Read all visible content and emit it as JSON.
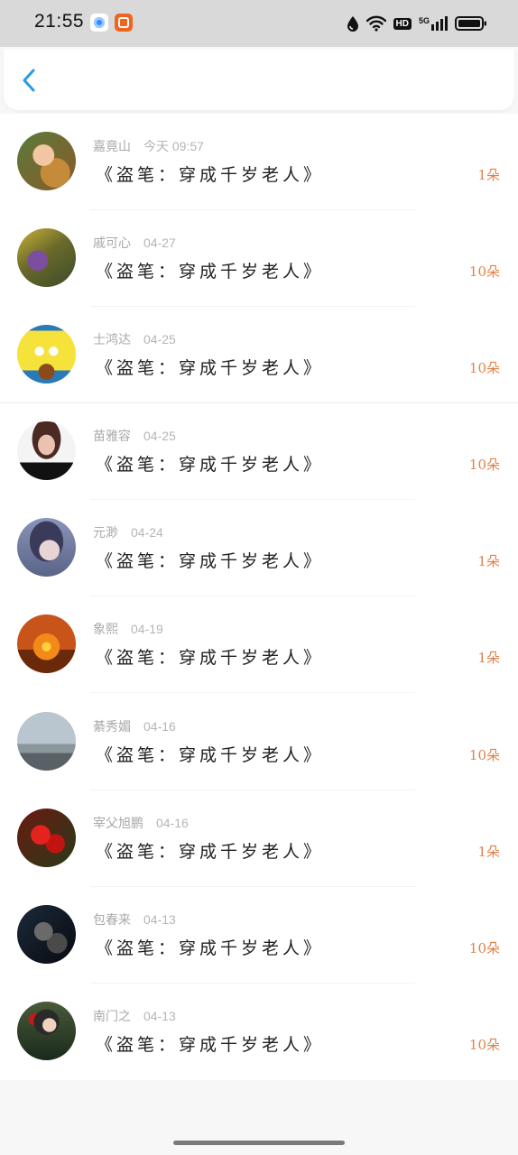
{
  "status_bar": {
    "time": "21:55",
    "icons": [
      "app-icon-blue",
      "app-icon-orange",
      "water-drop-icon",
      "wifi-icon",
      "hd-badge",
      "signal-icon",
      "battery-icon"
    ],
    "hd_label": "HD",
    "network_label": "5G"
  },
  "header": {
    "back_icon": "chevron-left-icon",
    "accent_color": "#2a9be0"
  },
  "list": {
    "count_color": "#e0814a",
    "items": [
      {
        "name": "嘉竟山",
        "date": "今天 09:57",
        "title": "《盗笔：穿成千岁老人》",
        "count": "1朵"
      },
      {
        "name": "戚可心",
        "date": "04-27",
        "title": "《盗笔：穿成千岁老人》",
        "count": "10朵"
      },
      {
        "name": "士鸿达",
        "date": "04-25",
        "title": "《盗笔：穿成千岁老人》",
        "count": "10朵"
      },
      {
        "name": "苗雅容",
        "date": "04-25",
        "title": "《盗笔：穿成千岁老人》",
        "count": "10朵"
      },
      {
        "name": "元渺",
        "date": "04-24",
        "title": "《盗笔：穿成千岁老人》",
        "count": "1朵"
      },
      {
        "name": "象熙",
        "date": "04-19",
        "title": "《盗笔：穿成千岁老人》",
        "count": "1朵"
      },
      {
        "name": "綦秀媚",
        "date": "04-16",
        "title": "《盗笔：穿成千岁老人》",
        "count": "10朵"
      },
      {
        "name": "宰父旭鹏",
        "date": "04-16",
        "title": "《盗笔：穿成千岁老人》",
        "count": "1朵"
      },
      {
        "name": "包春来",
        "date": "04-13",
        "title": "《盗笔：穿成千岁老人》",
        "count": "10朵"
      },
      {
        "name": "南门之",
        "date": "04-13",
        "title": "《盗笔：穿成千岁老人》",
        "count": "10朵"
      }
    ]
  }
}
